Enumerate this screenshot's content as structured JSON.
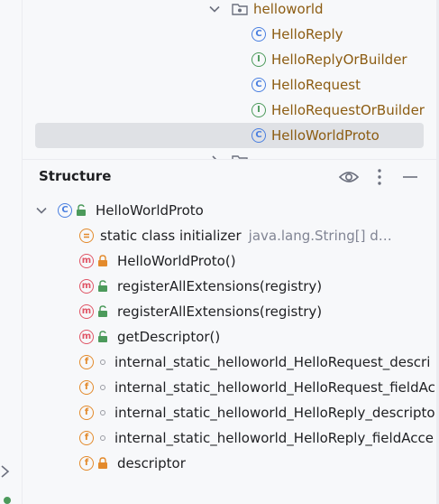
{
  "project_tree": {
    "package": {
      "label": "helloworld"
    },
    "items": [
      {
        "label": "HelloReply",
        "kind": "class"
      },
      {
        "label": "HelloReplyOrBuilder",
        "kind": "interface"
      },
      {
        "label": "HelloRequest",
        "kind": "class"
      },
      {
        "label": "HelloRequestOrBuilder",
        "kind": "interface"
      },
      {
        "label": "HelloWorldProto",
        "kind": "class",
        "selected": true
      }
    ]
  },
  "structure": {
    "title": "Structure",
    "header_icons": [
      "eye-icon",
      "more-vertical-icon",
      "minimize-icon"
    ],
    "root": {
      "label": "HelloWorldProto",
      "icon": "class-icon",
      "expanded": true
    },
    "members": [
      {
        "label": "static class initializer",
        "hint": "java.lang.String[] d…",
        "icon": "static-initializer-icon",
        "access": "none"
      },
      {
        "label": "HelloWorldProto()",
        "icon": "method-icon",
        "access": "private"
      },
      {
        "label": "registerAllExtensions(registry)",
        "icon": "method-icon",
        "access": "public"
      },
      {
        "label": "registerAllExtensions(registry)",
        "icon": "method-icon",
        "access": "public"
      },
      {
        "label": "getDescriptor()",
        "icon": "method-icon",
        "access": "public"
      },
      {
        "label": "internal_static_helloworld_HelloRequest_descri",
        "icon": "field-icon",
        "access": "package"
      },
      {
        "label": "internal_static_helloworld_HelloRequest_fieldAc",
        "icon": "field-icon",
        "access": "package"
      },
      {
        "label": "internal_static_helloworld_HelloReply_descripto",
        "icon": "field-icon",
        "access": "package"
      },
      {
        "label": "internal_static_helloworld_HelloReply_fieldAcce",
        "icon": "field-icon",
        "access": "package"
      },
      {
        "label": "descriptor",
        "icon": "field-icon",
        "access": "private"
      }
    ]
  },
  "colors": {
    "accent_blue": "#4a7fe0",
    "interface_green": "#4c9a5b",
    "method_red": "#e05566",
    "field_orange": "#e38a2c",
    "class_name_brown": "#8c5c12",
    "selection": "#dfe1e5"
  }
}
